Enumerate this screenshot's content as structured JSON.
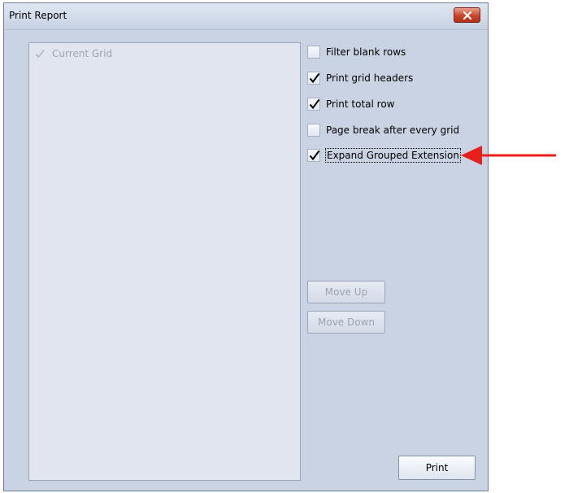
{
  "window": {
    "title": "Print Report"
  },
  "grid_list": {
    "items": [
      {
        "label": "Current Grid",
        "checked": true
      }
    ]
  },
  "options": [
    {
      "label": "Filter blank rows",
      "checked": false
    },
    {
      "label": "Print grid headers",
      "checked": true
    },
    {
      "label": "Print total row",
      "checked": true
    },
    {
      "label": "Page break after every grid",
      "checked": false
    },
    {
      "label": "Expand Grouped Extension",
      "checked": true
    }
  ],
  "buttons": {
    "move_up": "Move Up",
    "move_down": "Move Down",
    "print": "Print"
  },
  "colors": {
    "annotation_arrow": "#e8201c",
    "window_bg": "#c9d3e3"
  },
  "icons": {
    "close": "close-icon",
    "check": "checkmark-icon",
    "annotation": "red-arrow-icon"
  }
}
